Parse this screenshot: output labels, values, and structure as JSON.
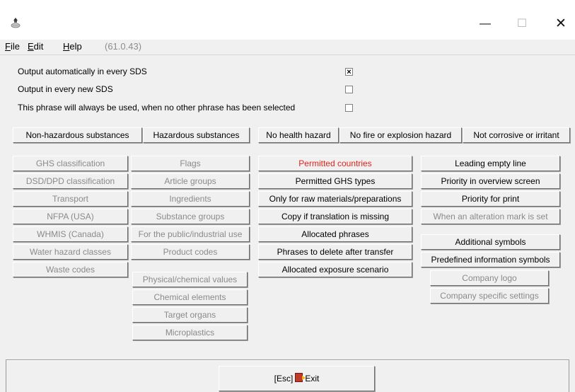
{
  "window": {
    "minimize_glyph": "—",
    "maximize_glyph": "☐",
    "close_glyph": "✕"
  },
  "menu": {
    "file": "File",
    "edit": "Edit",
    "help": "Help",
    "version": "(61.0.43)"
  },
  "options": [
    {
      "label": "Output automatically in every SDS",
      "checked": true,
      "mark": "×"
    },
    {
      "label": "Output in every new SDS",
      "checked": false,
      "mark": ""
    },
    {
      "label": "This phrase will always be used, when no other phrase has been selected",
      "checked": false,
      "mark": ""
    }
  ],
  "category_buttons": [
    "Non-hazardous substances",
    "Hazardous substances",
    "No health hazard",
    "No fire or explosion hazard",
    "Not corrosive or irritant"
  ],
  "col1": [
    "GHS classification",
    "DSD/DPD classification",
    "Transport",
    "NFPA (USA)",
    "WHMIS (Canada)",
    "Water hazard classes",
    "Waste codes"
  ],
  "col2": [
    "Flags",
    "Article groups",
    "Ingredients",
    "Substance groups",
    "For the public/industrial use",
    "Product codes"
  ],
  "col2b": [
    "Physical/chemical values",
    "Chemical elements",
    "Target organs",
    "Microplastics"
  ],
  "col3": [
    "Permitted countries",
    "Permitted GHS types",
    "Only for raw materials/preparations",
    "Copy if translation is missing",
    "Allocated phrases",
    "Phrases to delete after transfer",
    "Allocated exposure scenario"
  ],
  "col4": [
    "Leading empty line",
    "Priority in overview screen",
    "Priority for print",
    "When an alteration mark is set"
  ],
  "col4b": [
    "Additional symbols",
    "Predefined information symbols",
    "Company logo",
    "Company specific settings"
  ],
  "footer": {
    "esc": "[Esc]",
    "exit": "Exit"
  },
  "colors": {
    "accent_red": "#e3211b",
    "disabled_text": "#8a8a8a"
  }
}
